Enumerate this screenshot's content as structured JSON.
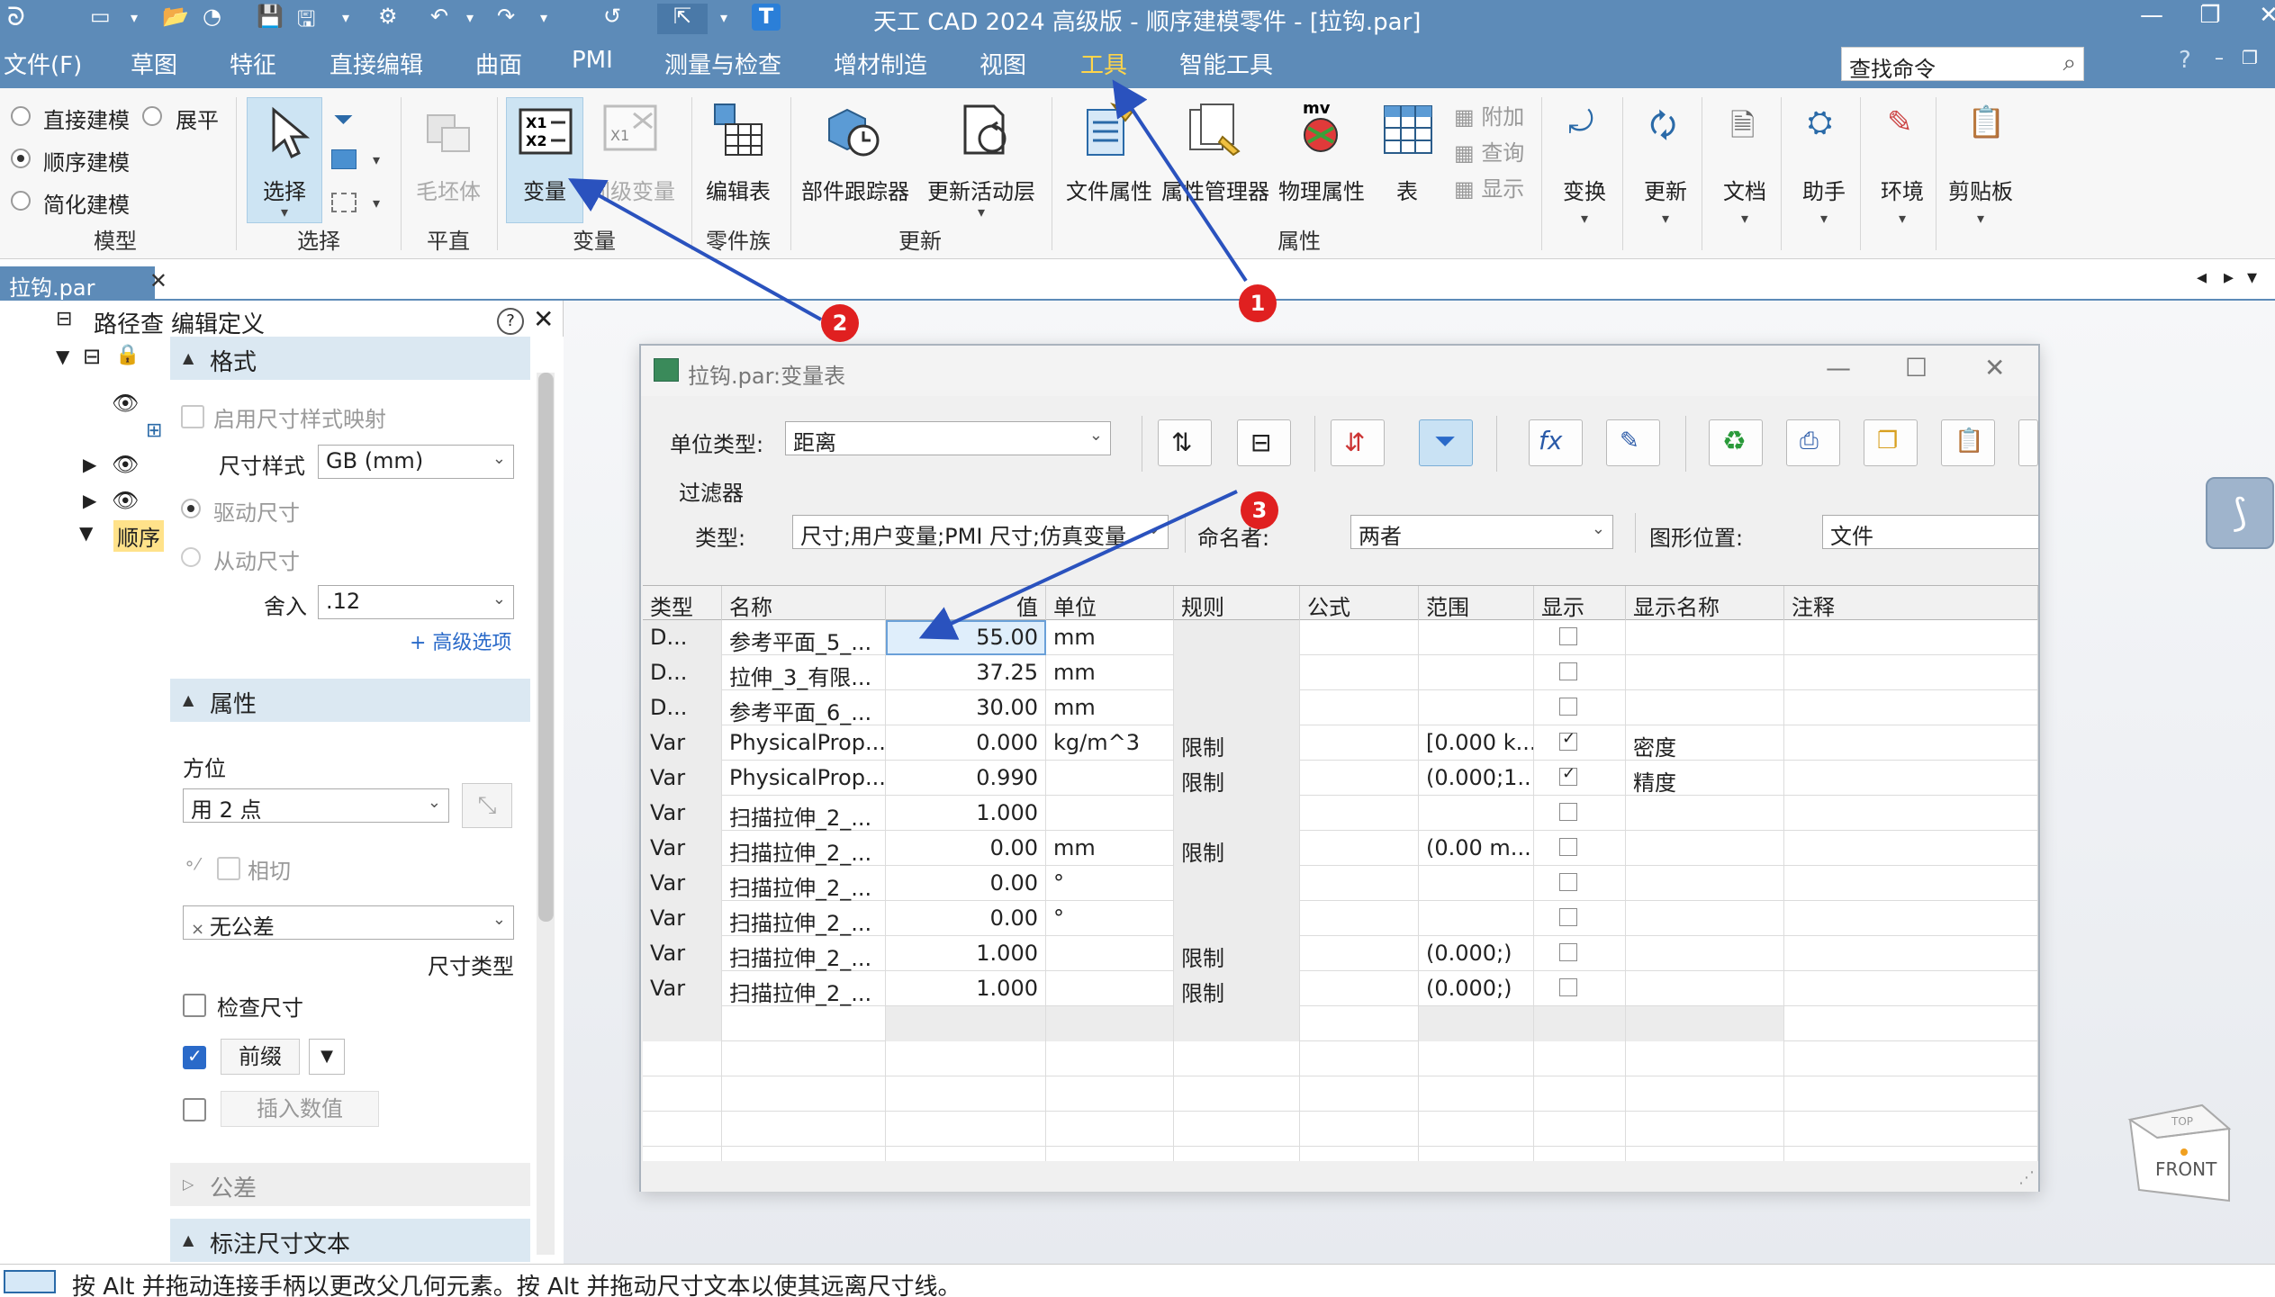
{
  "app": {
    "title": "天工 CAD 2024 高级版 - 顺序建模零件 - [拉钩.par]",
    "window_controls": [
      "—",
      "❐",
      "✕"
    ]
  },
  "menu": {
    "items": [
      "文件(F)",
      "草图",
      "特征",
      "直接编辑",
      "曲面",
      "PMI",
      "测量与检查",
      "增材制造",
      "视图",
      "工具",
      "智能工具"
    ],
    "active": "工具",
    "search_placeholder": "查找命令",
    "help": "?"
  },
  "ribbon": {
    "model": {
      "options": [
        "直接建模",
        "顺序建模",
        "简化建模"
      ],
      "flatten": "展平",
      "selected": "顺序建模",
      "label": "模型"
    },
    "select": {
      "button": "选择",
      "label": "选择"
    },
    "flat": {
      "button": "毛坯体",
      "label": "平直"
    },
    "variables": {
      "button": "变量",
      "peer": "同级变量",
      "label": "变量"
    },
    "family": {
      "button": "编辑表",
      "label": "零件族"
    },
    "update": {
      "tracker": "部件跟踪器",
      "refresh": "更新活动层",
      "label": "更新"
    },
    "props": {
      "file_props": "文件属性",
      "prop_mgr": "属性管理器",
      "phys_props": "物理属性",
      "table": "表",
      "attach": "附加",
      "query": "查询",
      "show": "显示",
      "label": "属性"
    },
    "right_buttons": [
      "变换",
      "更新",
      "文档",
      "助手",
      "环境",
      "剪贴板"
    ]
  },
  "doc_tab": {
    "name": "拉钩.par",
    "close": "✕"
  },
  "left_panel": {
    "pathfinder": "路径查",
    "edit_def": "编辑定义",
    "tree_highlight": "顺序",
    "format_section": "格式",
    "enable_map": "启用尺寸样式映射",
    "dim_style_label": "尺寸样式",
    "dim_style_value": "GB (mm)",
    "driving": "驱动尺寸",
    "driven": "从动尺寸",
    "round_label": "舍入",
    "round_value": ".12",
    "advanced": "+ 高级选项",
    "props_section": "属性",
    "orientation_label": "方位",
    "orientation_value": "用 2 点",
    "tangent": "相切",
    "tolerance_value": "无公差",
    "dim_type": "尺寸类型",
    "check_dim": "检查尺寸",
    "prefix": "前缀",
    "insert_value": "插入数值",
    "tolerance_section": "公差",
    "text_section": "标注尺寸文本"
  },
  "dialog": {
    "title": "拉钩.par:变量表",
    "unit_type_label": "单位类型:",
    "unit_type_value": "距离",
    "filter_title": "过滤器",
    "type_label": "类型:",
    "type_value": "尺寸;用户变量;PMI 尺寸;仿真变量",
    "namer_label": "命名者:",
    "namer_value": "两者",
    "graphic_label": "图形位置:",
    "graphic_value": "文件",
    "columns": [
      "类型",
      "名称",
      "值",
      "单位",
      "规则",
      "公式",
      "范围",
      "显示",
      "显示名称",
      "注释"
    ],
    "rows": [
      {
        "type": "D...",
        "name": "参考平面_5_...",
        "value": "55.00",
        "unit": "mm",
        "rule": "",
        "range": "",
        "show": false,
        "display_name": ""
      },
      {
        "type": "D...",
        "name": "拉伸_3_有限...",
        "value": "37.25",
        "unit": "mm",
        "rule": "",
        "range": "",
        "show": false,
        "display_name": ""
      },
      {
        "type": "D...",
        "name": "参考平面_6_...",
        "value": "30.00",
        "unit": "mm",
        "rule": "",
        "range": "",
        "show": false,
        "display_name": ""
      },
      {
        "type": "Var",
        "name": "PhysicalProp...",
        "value": "0.000",
        "unit": "kg/m^3",
        "rule": "限制",
        "range": "[0.000 k...",
        "show": true,
        "display_name": "密度"
      },
      {
        "type": "Var",
        "name": "PhysicalProp...",
        "value": "0.990",
        "unit": "",
        "rule": "限制",
        "range": "(0.000;1...",
        "show": true,
        "display_name": "精度"
      },
      {
        "type": "Var",
        "name": "扫描拉伸_2_...",
        "value": "1.000",
        "unit": "",
        "rule": "",
        "range": "",
        "show": false,
        "display_name": ""
      },
      {
        "type": "Var",
        "name": "扫描拉伸_2_...",
        "value": "0.00",
        "unit": "mm",
        "rule": "限制",
        "range": "(0.00 m...",
        "show": false,
        "display_name": ""
      },
      {
        "type": "Var",
        "name": "扫描拉伸_2_...",
        "value": "0.00",
        "unit": "°",
        "rule": "",
        "range": "",
        "show": false,
        "display_name": ""
      },
      {
        "type": "Var",
        "name": "扫描拉伸_2_...",
        "value": "0.00",
        "unit": "°",
        "rule": "",
        "range": "",
        "show": false,
        "display_name": ""
      },
      {
        "type": "Var",
        "name": "扫描拉伸_2_...",
        "value": "1.000",
        "unit": "",
        "rule": "限制",
        "range": "(0.000;)",
        "show": false,
        "display_name": ""
      },
      {
        "type": "Var",
        "name": "扫描拉伸_2_...",
        "value": "1.000",
        "unit": "",
        "rule": "限制",
        "range": "(0.000;)",
        "show": false,
        "display_name": ""
      }
    ]
  },
  "view_cube": {
    "top": "TOP",
    "front": "FRONT"
  },
  "status": {
    "text": "按 Alt 并拖动连接手柄以更改父几何元素。按 Alt 并拖动尺寸文本以使其远离尺寸线。"
  },
  "callouts": [
    "1",
    "2",
    "3"
  ],
  "colors": {
    "brand": "#5d8bb8",
    "active_menu": "#ffd54a",
    "callout": "#e02020",
    "arrow": "#2a52be"
  }
}
